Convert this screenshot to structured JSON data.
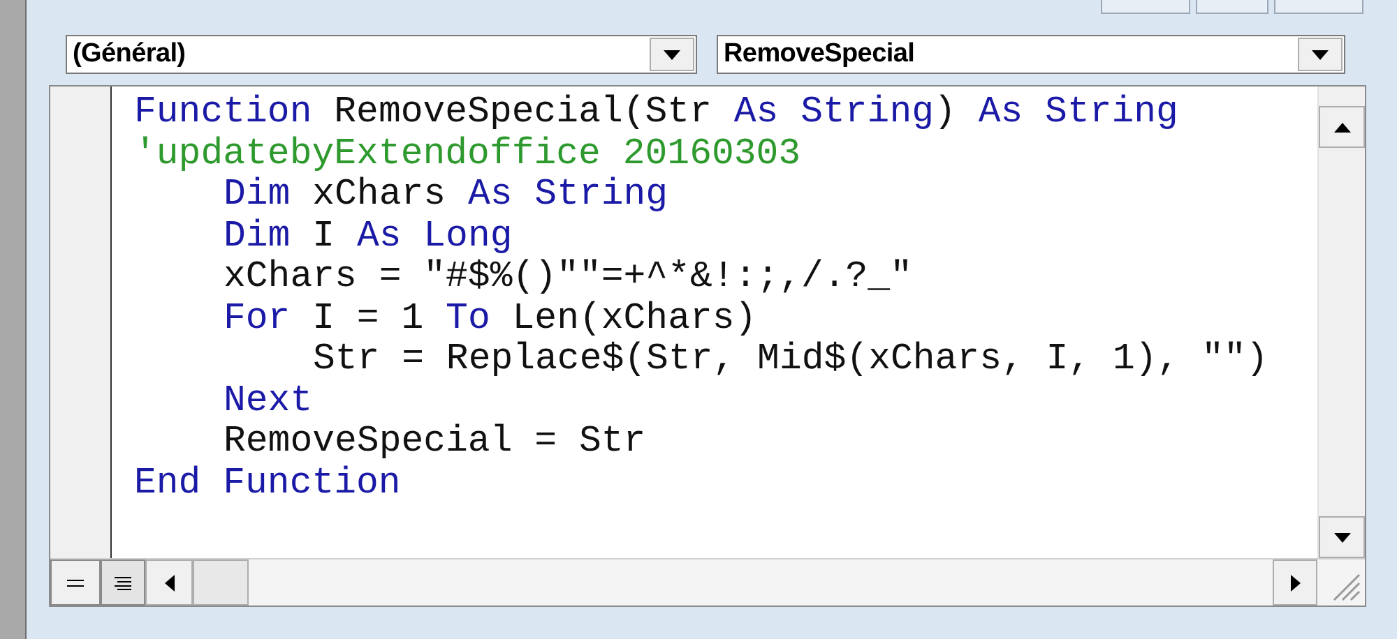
{
  "object_dropdown": {
    "value": "(Général)"
  },
  "procedure_dropdown": {
    "value": "RemoveSpecial"
  },
  "code_lines": [
    {
      "tokens": [
        {
          "kind": "keyword",
          "text": "Function"
        },
        {
          "kind": "plain",
          "text": " RemoveSpecial(Str "
        },
        {
          "kind": "keyword",
          "text": "As String"
        },
        {
          "kind": "plain",
          "text": ") "
        },
        {
          "kind": "keyword",
          "text": "As String"
        }
      ]
    },
    {
      "tokens": [
        {
          "kind": "comment",
          "text": "'updatebyExtendoffice 20160303"
        }
      ],
      "children": [
        {
          "tokens": [
            {
              "kind": "keyword",
              "text": "Dim"
            },
            {
              "kind": "plain",
              "text": " xChars "
            },
            {
              "kind": "keyword",
              "text": "As String"
            }
          ]
        },
        {
          "tokens": [
            {
              "kind": "keyword",
              "text": "Dim"
            },
            {
              "kind": "plain",
              "text": " I "
            },
            {
              "kind": "keyword",
              "text": "As Long"
            }
          ]
        },
        {
          "tokens": [
            {
              "kind": "plain",
              "text": "xChars = \"#$%()\"\"=+^*&!:;,/.?_\""
            }
          ]
        },
        {
          "tokens": [
            {
              "kind": "keyword",
              "text": "For"
            },
            {
              "kind": "plain",
              "text": " I = 1 "
            },
            {
              "kind": "keyword",
              "text": "To"
            },
            {
              "kind": "plain",
              "text": " Len(xChars)"
            }
          ],
          "children": [
            {
              "tokens": [
                {
                  "kind": "plain",
                  "text": "Str = Replace$(Str, Mid$(xChars, I, 1), \"\")"
                }
              ]
            }
          ]
        },
        {
          "tokens": [
            {
              "kind": "keyword",
              "text": "Next"
            }
          ]
        },
        {
          "tokens": [
            {
              "kind": "plain",
              "text": "RemoveSpecial = Str"
            }
          ]
        }
      ]
    },
    {
      "tokens": [
        {
          "kind": "keyword",
          "text": "End Function"
        }
      ]
    }
  ]
}
